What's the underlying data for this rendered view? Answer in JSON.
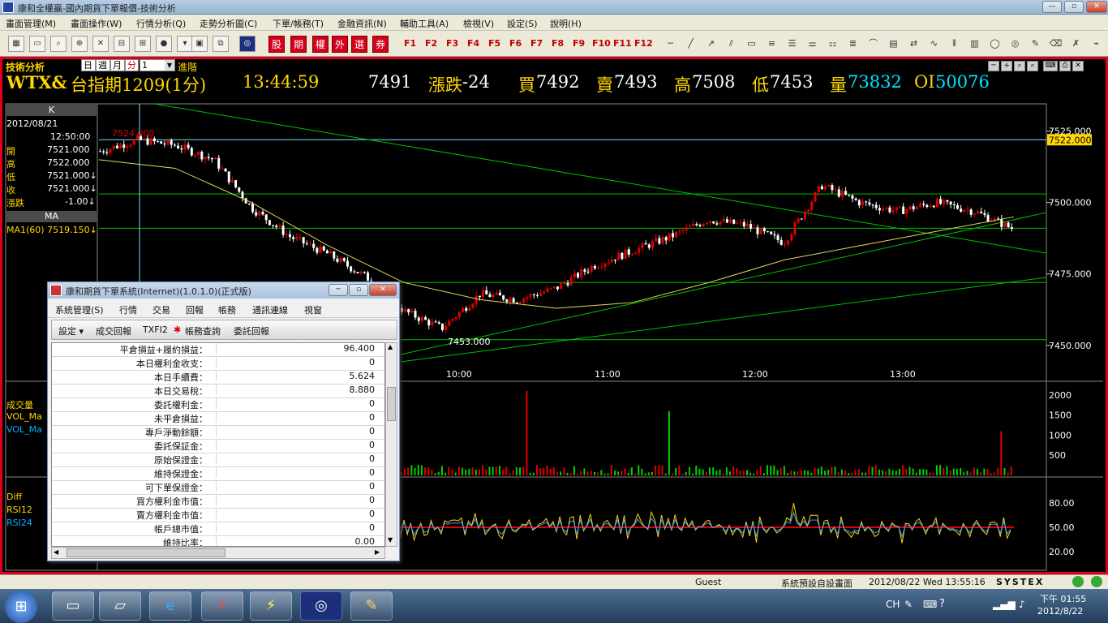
{
  "window": {
    "title": "康和全權贏-國內期貨下單報價-技術分析",
    "buttons": [
      "—",
      "▫",
      "✕"
    ]
  },
  "menu": [
    "畫面管理(M)",
    "畫面操作(W)",
    "行情分析(Q)",
    "走勢分析圖(C)",
    "下單/帳務(T)",
    "金融資訊(N)",
    "輔助工具(A)",
    "檢視(V)",
    "設定(S)",
    "說明(H)"
  ],
  "toolbar": {
    "quick_buttons": [
      "股",
      "期",
      "權",
      "外",
      "選",
      "券"
    ],
    "fkeys": [
      "F1",
      "F2",
      "F3",
      "F4",
      "F5",
      "F6",
      "F7",
      "F8",
      "F9",
      "F10",
      "F11",
      "F12"
    ]
  },
  "panel": {
    "title": "技術分析",
    "periods": [
      "日",
      "週",
      "月",
      "分"
    ],
    "count": "1",
    "advanced": "進階",
    "window_controls": [
      "─",
      "+",
      "⌕",
      "⌕",
      "⌨",
      "⎙",
      "✕"
    ]
  },
  "quote": {
    "code": "WTX&",
    "name": "台指期1209(1分)",
    "time": "13:44:59",
    "price": "7491",
    "change_label": "漲跌",
    "change": "-24",
    "bid_label": "買",
    "bid": "7492",
    "ask_label": "賣",
    "ask": "7493",
    "high_label": "高",
    "high": "7508",
    "low_label": "低",
    "low": "7453",
    "volume_label": "量",
    "volume": "73832",
    "oi_label": "OI",
    "oi": "50076"
  },
  "side_info": {
    "header": "K",
    "date": "2012/08/21",
    "time": "12:50:00",
    "rows": [
      {
        "label": "開",
        "value": "7521.000"
      },
      {
        "label": "高",
        "value": "7522.000"
      },
      {
        "label": "低",
        "value": "7521.000↓"
      },
      {
        "label": "收",
        "value": "7521.000↓"
      },
      {
        "label": "漲跌",
        "value": "-1.00↓"
      }
    ],
    "ma_header": "MA",
    "ma_value": "MA1(60) 7519.150↓",
    "vol_label": "成交量",
    "vol_ma1": "VOL_Ma",
    "vol_ma2": "VOL_Ma",
    "ind_diff": "Diff",
    "ind_rsi12": "RSI12",
    "ind_rsi24": "RSI24"
  },
  "chart_data": [
    {
      "type": "candlestick",
      "title": "台指期1209(1分)",
      "x": [
        "10:00",
        "11:00",
        "12:00",
        "13:00"
      ],
      "ylim": [
        7438,
        7534
      ],
      "yticks": [
        7525,
        7500,
        7475,
        7450
      ],
      "max_label": "7524.000",
      "min_label": "7453.000",
      "last_marker": "7522.000",
      "series": [
        {
          "name": "MA1(60)",
          "values": [
            7515,
            7512,
            7500,
            7485,
            7472,
            7466,
            7463,
            7465,
            7472,
            7480,
            7485,
            7490,
            7495
          ]
        }
      ],
      "close_path": [
        7518,
        7522,
        7520,
        7515,
        7498,
        7488,
        7482,
        7474,
        7462,
        7456,
        7468,
        7466,
        7470,
        7478,
        7483,
        7488,
        7494,
        7492,
        7486,
        7506,
        7500,
        7497,
        7500,
        7497,
        7491
      ]
    },
    {
      "type": "bar",
      "title": "成交量",
      "yticks": [
        2000,
        1500,
        1000,
        500
      ],
      "ylim": [
        0,
        2100
      ],
      "peaks": [
        2000,
        1400,
        2100,
        1100
      ]
    },
    {
      "type": "line",
      "title": "RSI",
      "yticks": [
        80,
        50,
        20
      ],
      "ylim": [
        0,
        100
      ],
      "series": [
        {
          "name": "RSI12"
        },
        {
          "name": "RSI24"
        },
        {
          "name": "Diff"
        }
      ]
    }
  ],
  "dialog": {
    "title": "康和期貨下單系統(Internet)(1.0.1.0)(正式版)",
    "menu": [
      "系統管理(S)",
      "行情",
      "交易",
      "回報",
      "帳務",
      "通訊連線",
      "視窗"
    ],
    "tools": [
      "設定 ▾",
      "成交回報",
      "TXFI2",
      "帳務查詢",
      "委託回報"
    ],
    "rows": [
      {
        "k": "平倉損益+履約損益：",
        "v": "96.400"
      },
      {
        "k": "本日權利金收支：",
        "v": "0"
      },
      {
        "k": "本日手續費：",
        "v": "5.624"
      },
      {
        "k": "本日交易稅：",
        "v": "8.880"
      },
      {
        "k": "委託權利金：",
        "v": "0"
      },
      {
        "k": "未平倉損益：",
        "v": "0"
      },
      {
        "k": "專戶淨動餘額：",
        "v": "0"
      },
      {
        "k": "委託保証金：",
        "v": "0"
      },
      {
        "k": "原始保證金：",
        "v": "0"
      },
      {
        "k": "維持保證金：",
        "v": "0"
      },
      {
        "k": "可下單保證金：",
        "v": "0"
      },
      {
        "k": "買方權利金市值：",
        "v": "0"
      },
      {
        "k": "賣方權利金市值：",
        "v": "0"
      },
      {
        "k": "帳戶總市值：",
        "v": "0"
      },
      {
        "k": "維持比率：",
        "v": "0.00"
      }
    ]
  },
  "status": {
    "user": "Guest",
    "layout": "系統預設自設畫面",
    "datetime": "2012/08/22 Wed 13:55:16",
    "brand": "SYSTEX"
  },
  "taskbar": {
    "ime": "CH",
    "time": "下午 01:55",
    "date": "2012/8/22"
  },
  "colors": {
    "up": "#e00000",
    "down": "#ffffff",
    "ma": "#e6d65a",
    "grid": "#00c000",
    "frame": "#e0001b",
    "panel": "#000000"
  }
}
